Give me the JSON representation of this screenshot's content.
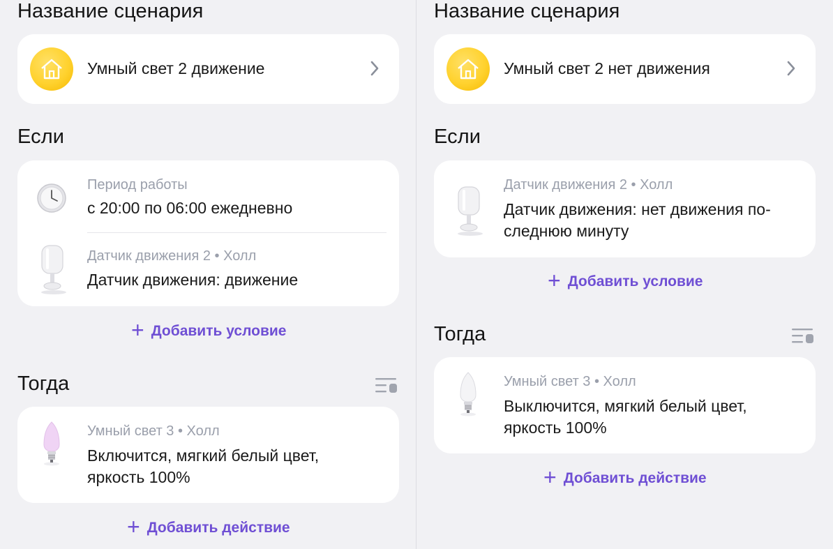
{
  "left": {
    "name_heading": "Название сценария",
    "name_value": "Умный свет 2 движение",
    "if_heading": "Если",
    "conditions": [
      {
        "subtitle": "Период работы",
        "text": "с 20:00 по 06:00 ежедневно",
        "icon": "clock-icon"
      },
      {
        "subtitle": "Датчик движения 2 • Холл",
        "text": "Датчик движения: движение",
        "icon": "motion-sensor-icon"
      }
    ],
    "add_condition": "Добавить условие",
    "then_heading": "Тогда",
    "actions": [
      {
        "subtitle": "Умный свет 3 • Холл",
        "text_line1": "Включится, мягкий белый цвет,",
        "text_line2": "яркость 100%",
        "icon": "light-bulb-icon",
        "bulb_color": "#f0d4f5"
      }
    ],
    "add_action": "Добавить действие"
  },
  "right": {
    "name_heading": "Название сценария",
    "name_value": "Умный свет 2 нет движения",
    "if_heading": "Если",
    "conditions": [
      {
        "subtitle": "Датчик движения 2 • Холл",
        "text_line1": "Датчик движения: нет движения по-",
        "text_line2": "следнюю минуту",
        "icon": "motion-sensor-icon"
      }
    ],
    "add_condition": "Добавить условие",
    "then_heading": "Тогда",
    "actions": [
      {
        "subtitle": "Умный свет 3 • Холл",
        "text_line1": "Выключится, мягкий белый цвет,",
        "text_line2": "яркость 100%",
        "icon": "light-bulb-icon",
        "bulb_color": "#f4f4f6"
      }
    ],
    "add_action": "Добавить действие"
  },
  "colors": {
    "accent": "#6f4fd4",
    "background": "#f1f1f4",
    "card": "#ffffff",
    "subtitle": "#9a9fab",
    "house_icon": "#ffd22e"
  }
}
